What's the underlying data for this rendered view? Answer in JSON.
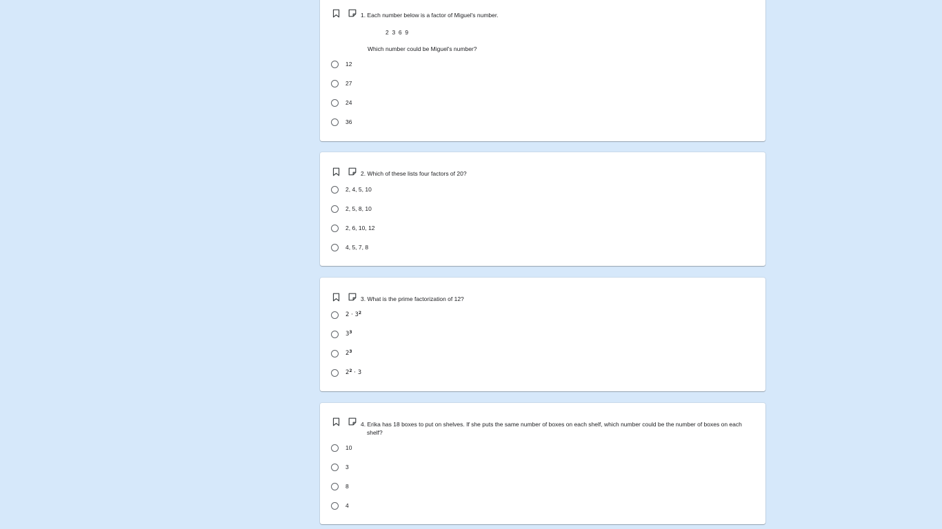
{
  "colors": {
    "background": "#d6e8fa",
    "card": "#ffffff",
    "radio_border": "#5f6368",
    "text": "#202124"
  },
  "questions": [
    {
      "number": "1.",
      "text": "Each number below is a factor of Miguel's number.",
      "factors": "2  3  6  9",
      "prompt": "Which number could be Miguel's number?",
      "options": [
        "12",
        "27",
        "24",
        "36"
      ],
      "icons": [
        "bookmark-icon",
        "note-icon"
      ]
    },
    {
      "number": "2.",
      "text": "Which of these lists four factors of 20?",
      "options": [
        "2, 4, 5, 10",
        "2, 5, 8, 10",
        "2, 6, 10, 12",
        "4, 5, 7, 8"
      ],
      "icons": [
        "bookmark-icon",
        "note-icon"
      ]
    },
    {
      "number": "3.",
      "text": "What is the prime factorization of 12?",
      "options": [
        {
          "base": "2 · 3",
          "exp": "2",
          "tail": ""
        },
        {
          "base": "3",
          "exp": "3",
          "tail": ""
        },
        {
          "base": "2",
          "exp": "3",
          "tail": ""
        },
        {
          "base": "2",
          "exp": "2",
          "tail": " · 3"
        }
      ],
      "icons": [
        "bookmark-icon",
        "note-icon"
      ]
    },
    {
      "number": "4.",
      "text": "Erika has 18 boxes to put on shelves. If she puts the same number of boxes on each shelf, which number could be the number of boxes on each",
      "text_cont": "shelf?",
      "options": [
        "10",
        "3",
        "8",
        "4"
      ],
      "icons": [
        "bookmark-icon",
        "note-icon"
      ]
    }
  ]
}
